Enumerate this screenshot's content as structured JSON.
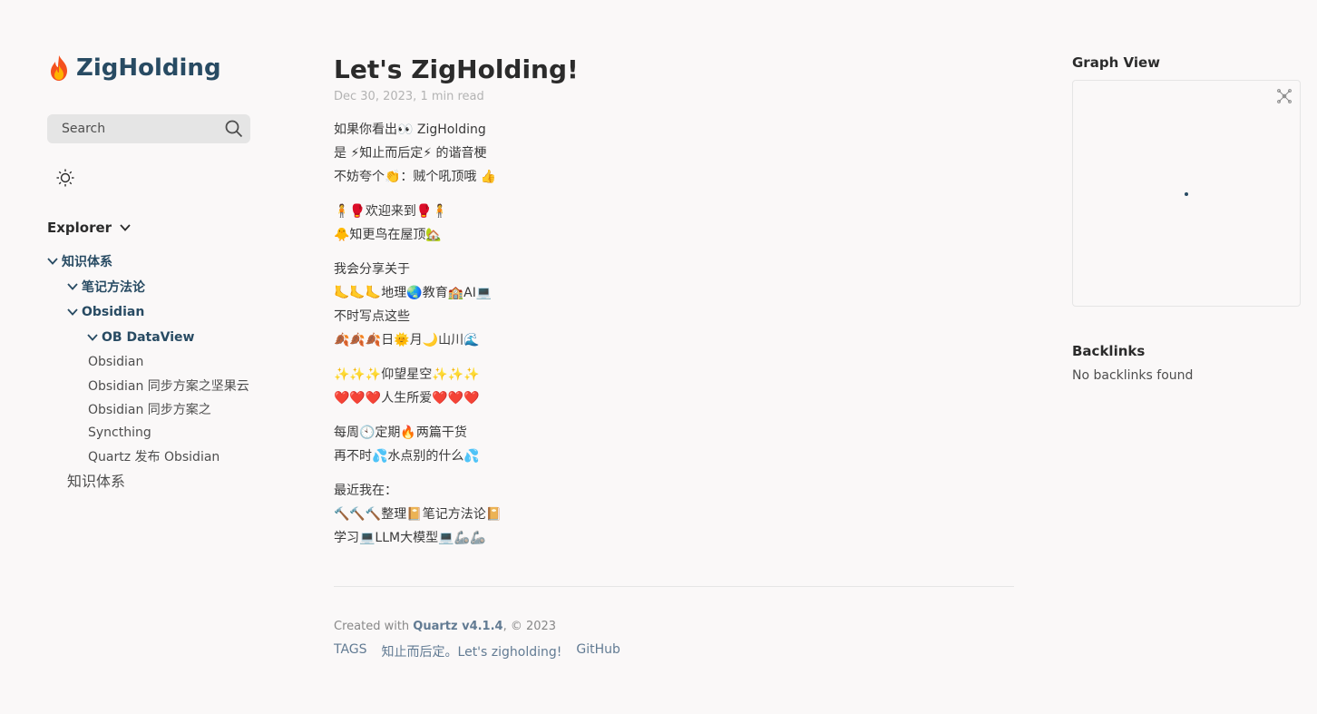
{
  "site": {
    "title": "ZigHolding",
    "search_placeholder": "Search",
    "brand_color": "#284b63"
  },
  "explorer": {
    "title": "Explorer",
    "tree": [
      {
        "label": "知识体系",
        "type": "folder",
        "depth": 0
      },
      {
        "label": "笔记方法论",
        "type": "folder",
        "depth": 1
      },
      {
        "label": "Obsidian",
        "type": "folder",
        "depth": 1
      },
      {
        "label": "OB DataView",
        "type": "folder",
        "depth": 2
      },
      {
        "label": "Obsidian",
        "type": "file",
        "depth": 2
      },
      {
        "label": "Obsidian 同步方案之坚果云",
        "type": "file",
        "depth": 2
      },
      {
        "label": "Obsidian 同步方案之",
        "type": "file",
        "depth": 2
      },
      {
        "label": "Syncthing",
        "type": "file",
        "depth": 2
      },
      {
        "label": "Quartz 发布 Obsidian",
        "type": "file",
        "depth": 2
      },
      {
        "label": "知识体系",
        "type": "file",
        "depth": 1
      }
    ]
  },
  "article": {
    "title": "Let's ZigHolding!",
    "meta": "Dec 30, 2023, 1 min read",
    "paragraphs": [
      [
        "如果你看出👀 ZigHolding",
        "是 ⚡知止而后定⚡ 的谐音梗",
        "不妨夸个👏：贼个吼顶哦 👍"
      ],
      [
        "🧍🥊欢迎来到🥊🧍",
        "🐥知更鸟在屋顶🏡"
      ],
      [
        "我会分享关于",
        "🦶🦶🦶地理🌏教育🏫AI💻",
        "不时写点这些",
        "🍂🍂🍂日🌞月🌙山川🌊"
      ],
      [
        "✨✨✨仰望星空✨✨✨",
        "❤️❤️❤️人生所爱❤️❤️❤️"
      ],
      [
        "每周🕙定期🔥两篇干货",
        "再不时💦水点别的什么💦"
      ],
      [
        "最近我在：",
        "🔨🔨🔨整理📔笔记方法论📔",
        "学习💻LLM大模型💻🦾🦾"
      ]
    ]
  },
  "footer": {
    "created_prefix": "Created with ",
    "quartz_link": "Quartz v4.1.4",
    "created_suffix": ", © 2023",
    "links": [
      "TAGS",
      "知止而后定。Let's zigholding!",
      "GitHub"
    ]
  },
  "sidebar_right": {
    "graph_title": "Graph View",
    "backlinks_title": "Backlinks",
    "backlinks_empty": "No backlinks found"
  },
  "icons": {
    "logo": "fire-icon",
    "search": "search-icon",
    "theme": "sun-icon",
    "explorer_toggle": "chevron-down-icon",
    "graph_global": "global-graph-icon"
  }
}
